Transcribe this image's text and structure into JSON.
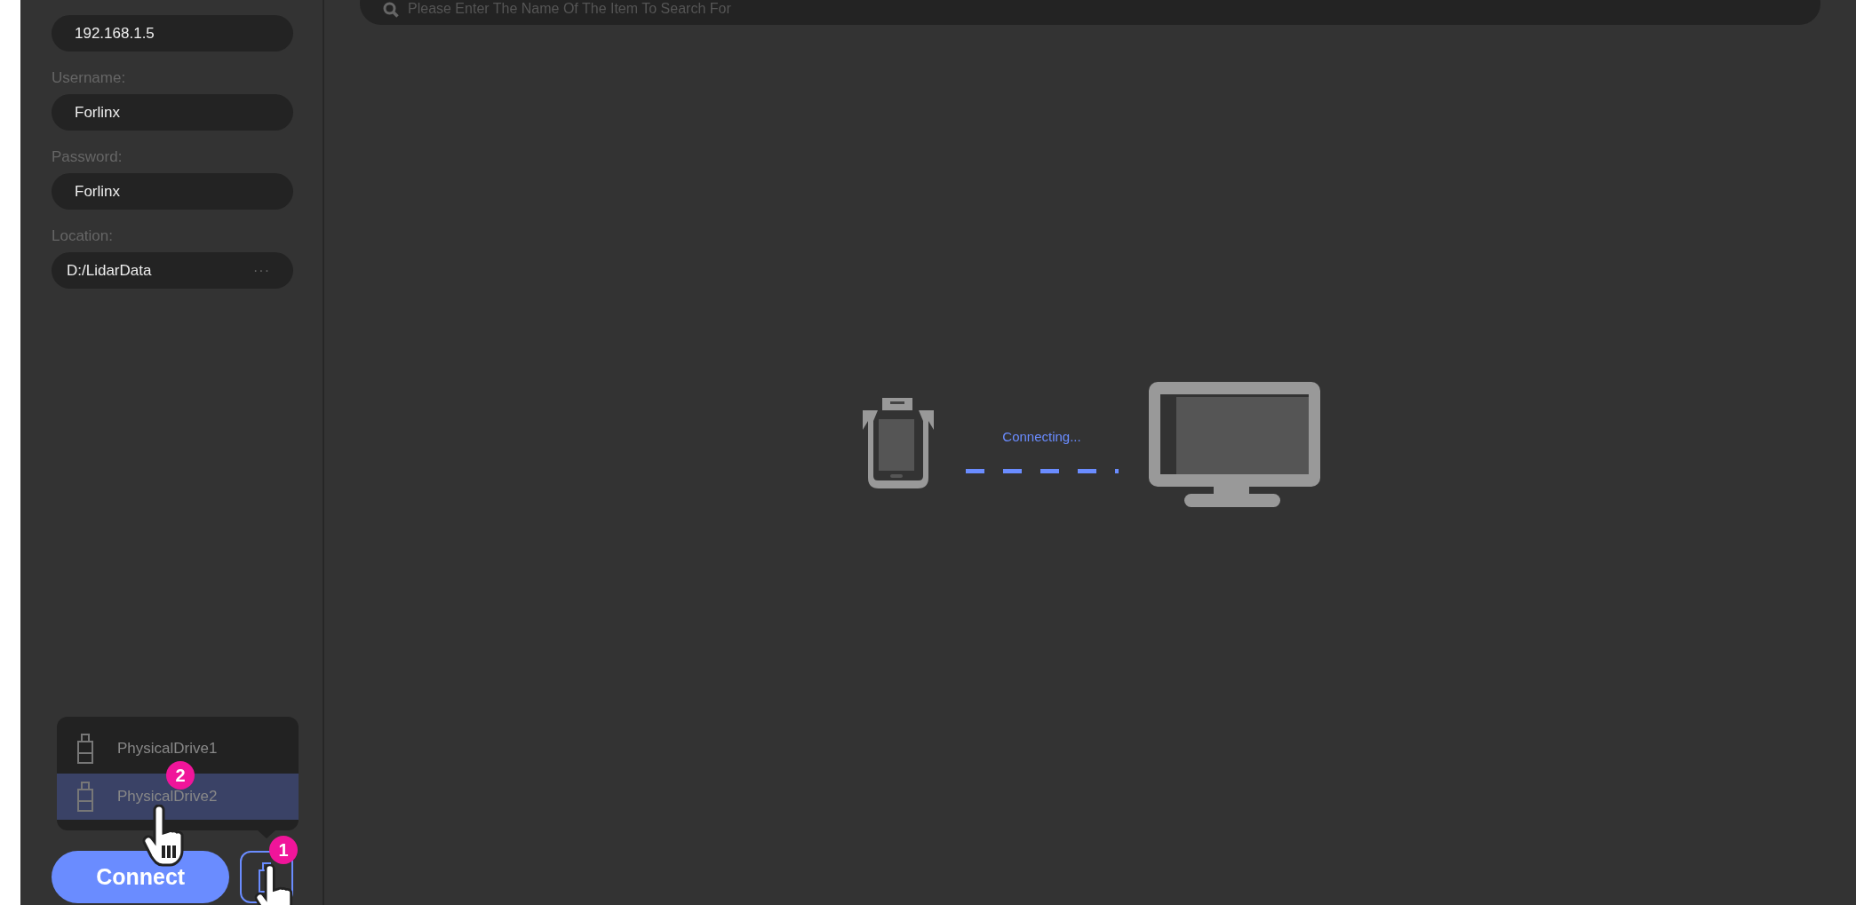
{
  "sidebar": {
    "fields": [
      {
        "value": "192.168.1.5"
      },
      {
        "label": "Username:",
        "value": "Forlinx"
      },
      {
        "label": "Password:",
        "value": "Forlinx"
      },
      {
        "label": "Location:",
        "value": "D:/LidarData",
        "browse": "···"
      }
    ],
    "drives": [
      {
        "name": "PhysicalDrive1",
        "selected": false
      },
      {
        "name": "PhysicalDrive2",
        "selected": true
      }
    ],
    "connect_button": "Connect"
  },
  "search": {
    "placeholder": "Please Enter The Name Of The Item To Search For"
  },
  "status": "Connecting...",
  "annotations": [
    {
      "number": "1"
    },
    {
      "number": "2"
    }
  ]
}
